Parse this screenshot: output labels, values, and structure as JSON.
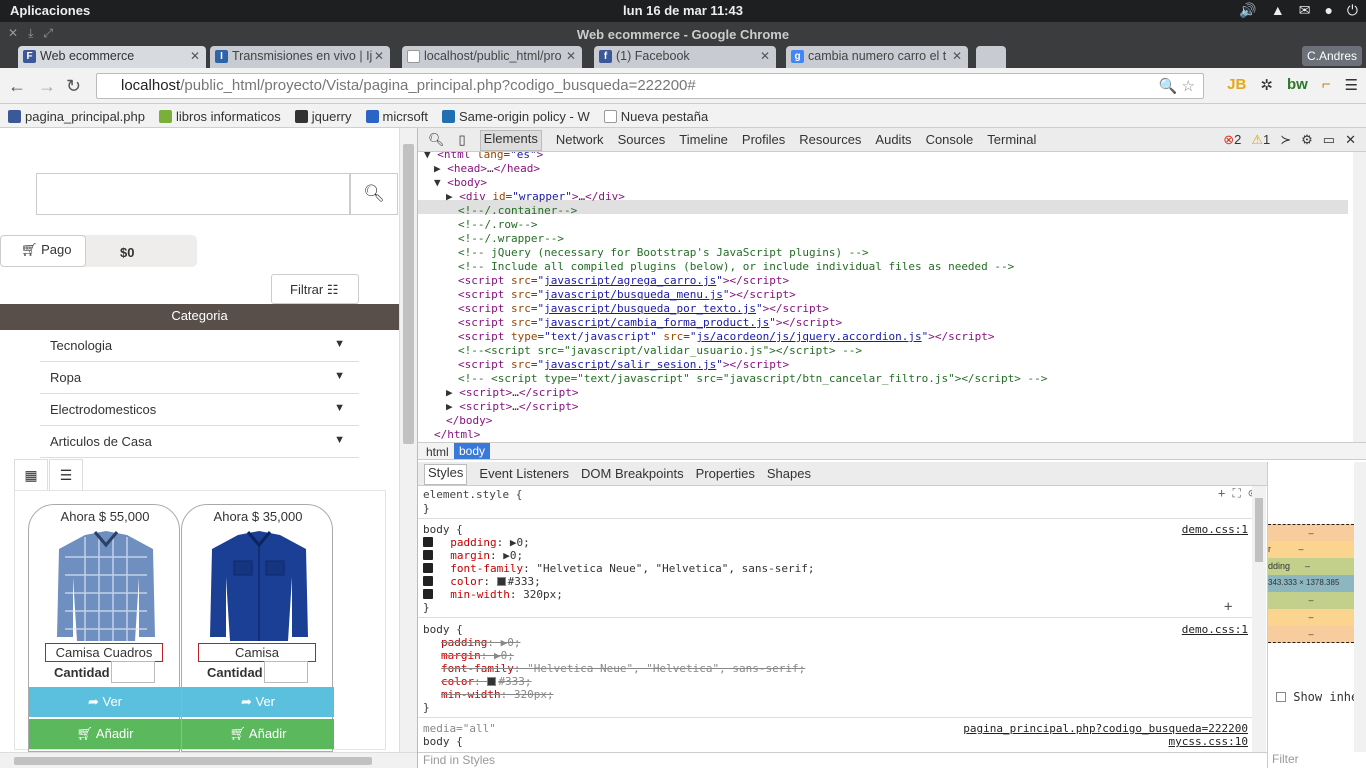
{
  "os": {
    "apps": "Aplicaciones",
    "clock": "lun 16 de mar 11:43"
  },
  "window": {
    "title": "Web ecommerce - Google Chrome",
    "user": "C.Andres"
  },
  "tabs": [
    {
      "label": "Web ecommerce",
      "color": "#3b5998",
      "icon": "F"
    },
    {
      "label": "Transmisiones en vivo | Ij",
      "color": "#2d64a8",
      "icon": "I"
    },
    {
      "label": "localhost/public_html/pro",
      "color": "#888",
      "icon": ""
    },
    {
      "label": "(1) Facebook",
      "color": "#3b5998",
      "icon": "f"
    },
    {
      "label": "cambia numero carro el t",
      "color": "#4285f4",
      "icon": "g"
    }
  ],
  "url": {
    "host": "localhost",
    "path": "/public_html/proyecto/Vista/pagina_principal.php?codigo_busqueda=222200#"
  },
  "bookmarks": [
    "pagina_principal.php",
    "libros informaticos",
    "jquerry",
    "micrsoft",
    "Same-origin policy - W",
    "Nueva pestaña"
  ],
  "page": {
    "pago": "Pago",
    "total": "$0",
    "filtrar": "Filtrar",
    "categoria": "Categoria",
    "categories": [
      "Tecnologia",
      "Ropa",
      "Electrodomesticos",
      "Articulos de Casa"
    ],
    "products": [
      {
        "price": "Ahora $ 55,000",
        "name": "Camisa Cuadros",
        "qty": "Cantidad",
        "ver": "Ver",
        "add": "Añadir"
      },
      {
        "price": "Ahora $ 35,000",
        "name": "Camisa",
        "qty": "Cantidad",
        "ver": "Ver",
        "add": "Añadir"
      }
    ]
  },
  "devtools": {
    "tabs": [
      "Elements",
      "Network",
      "Sources",
      "Timeline",
      "Profiles",
      "Resources",
      "Audits",
      "Console",
      "Terminal"
    ],
    "errors": "2",
    "warnings": "1",
    "crumbs": [
      "html",
      "body"
    ],
    "subtabs": [
      "Styles",
      "Event Listeners",
      "DOM Breakpoints",
      "Properties",
      "Shapes"
    ],
    "find_placeholder": "Find in Styles",
    "show_inherited": "Show inhe",
    "filter": "Filter",
    "box_value": "343.333 × 1378.385",
    "padding_label": "dding"
  }
}
